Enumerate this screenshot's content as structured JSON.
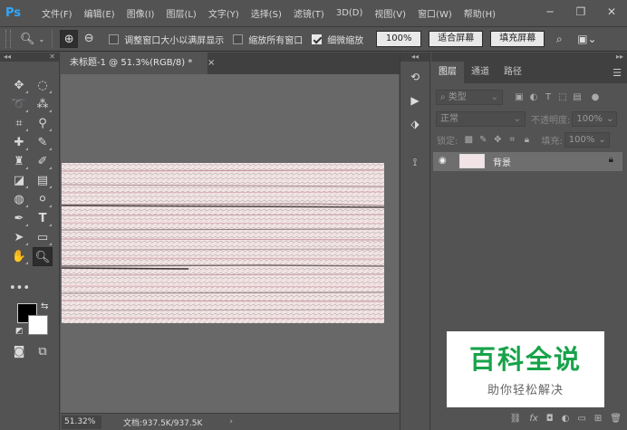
{
  "app": {
    "logo": "Ps"
  },
  "menu": [
    "文件(F)",
    "编辑(E)",
    "图像(I)",
    "图层(L)",
    "文字(Y)",
    "选择(S)",
    "滤镜(T)",
    "3D(D)",
    "视图(V)",
    "窗口(W)",
    "帮助(H)"
  ],
  "options": {
    "resize_windows": "调整窗口大小以满屏显示",
    "zoom_all": "缩放所有窗口",
    "scrubby_zoom": "细微缩放",
    "zoom_percent": "100%",
    "fit_screen": "适合屏幕",
    "fill_screen": "填充屏幕",
    "resize_checked": false,
    "zoom_all_checked": false,
    "scrubby_checked": true
  },
  "document": {
    "tab_title": "未标题-1 @ 51.3%(RGB/8) *",
    "close": "×"
  },
  "status": {
    "zoom": "51.32%",
    "doc_info": "文档:937.5K/937.5K"
  },
  "layers_panel": {
    "tabs": [
      "图层",
      "通道",
      "路径"
    ],
    "filter_kind": "类型",
    "blend_mode": "正常",
    "opacity_label": "不透明度:",
    "opacity": "100%",
    "lock_label": "锁定:",
    "fill_label": "填充:",
    "fill": "100%",
    "layer_name": "背景"
  },
  "watermark": {
    "title": "百科全说",
    "subtitle": "助你轻松解决"
  }
}
